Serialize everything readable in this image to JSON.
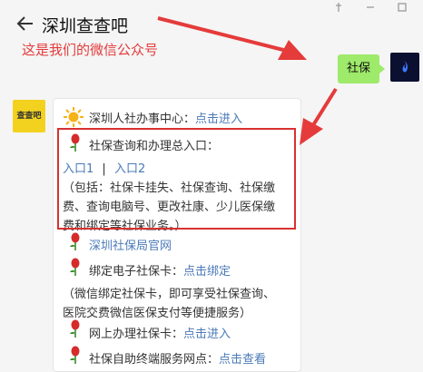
{
  "window": {
    "title": "深圳查查吧",
    "controls": [
      "pin-icon",
      "minimize-icon",
      "maximize-icon"
    ]
  },
  "annotation": {
    "label": "这是我们的微信公众号",
    "color": "#e53b3b"
  },
  "chat": {
    "user_message": "社保",
    "reply": {
      "avatar_label": "查查吧",
      "items": [
        {
          "icon": "sun-icon",
          "label": "深圳人社办事中心：",
          "link": "点击进入"
        },
        {
          "icon": "flower-icon",
          "label": "社保查询和办理总入口："
        },
        {
          "links": [
            "入口1",
            "入口2"
          ],
          "separator": "|"
        },
        {
          "text": "（包括：社保卡挂失、社保查询、社保缴"
        },
        {
          "text": "费、查询电脑号、更改社康、少儿医保缴"
        },
        {
          "text": "费和绑定等社保业务。）"
        },
        {
          "icon": "flower-icon",
          "link": "深圳社保局官网"
        },
        {
          "icon": "flower-icon",
          "label": "绑定电子社保卡：",
          "link": "点击绑定"
        },
        {
          "text": "（微信绑定社保卡，即可享受社保查询、"
        },
        {
          "text": "医院交费微信医保支付等便捷服务）"
        },
        {
          "icon": "flower-icon",
          "label": "网上办理社保卡：",
          "link": "点击进入"
        },
        {
          "icon": "flower-icon",
          "label": "社保自助终端服务网点：",
          "link": "点击查看"
        }
      ]
    }
  },
  "colors": {
    "link": "#4b7ab8",
    "bubble": "#9eea6a",
    "highlight": "#d93131"
  }
}
